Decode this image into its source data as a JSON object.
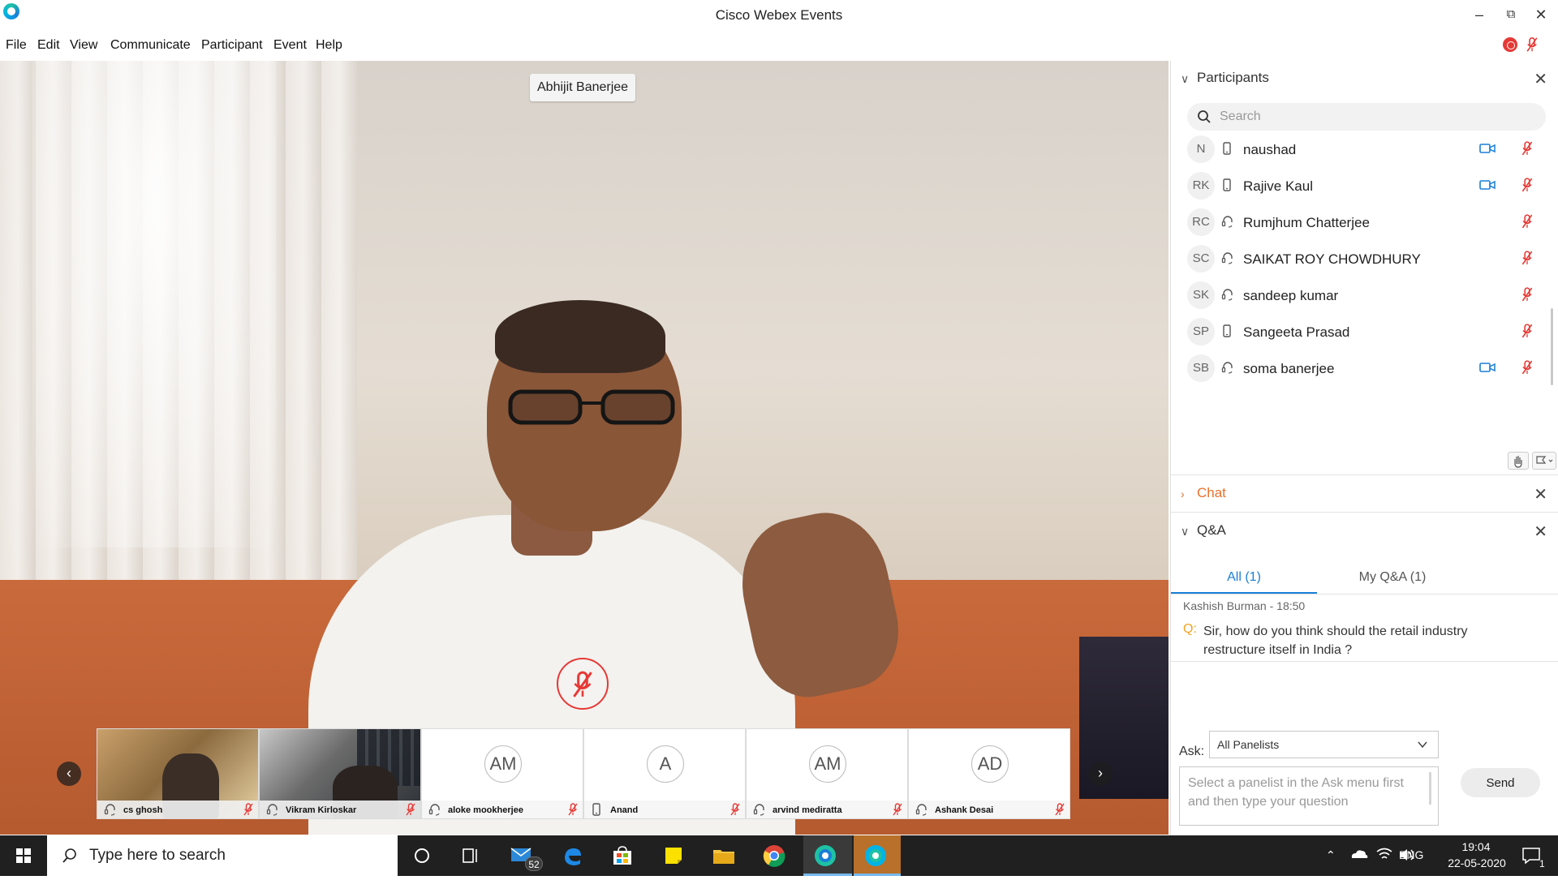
{
  "window": {
    "title": "Cisco Webex Events"
  },
  "menu": [
    {
      "label": "File"
    },
    {
      "label": "Edit"
    },
    {
      "label": "View"
    },
    {
      "label": "Communicate"
    },
    {
      "label": "Participant"
    },
    {
      "label": "Event"
    },
    {
      "label": "Help"
    }
  ],
  "video": {
    "active_speaker": "Abhijit Banerjee"
  },
  "filmstrip": [
    {
      "name": "cs ghosh",
      "initials": "",
      "device": "headset-icon",
      "has_video": true
    },
    {
      "name": "Vikram Kirloskar",
      "initials": "",
      "device": "headset-icon",
      "has_video": true
    },
    {
      "name": "aloke mookherjee",
      "initials": "AM",
      "device": "headset-icon",
      "has_video": false
    },
    {
      "name": "Anand",
      "initials": "A",
      "device": "phone-icon",
      "has_video": false
    },
    {
      "name": "arvind mediratta",
      "initials": "AM",
      "device": "headset-icon",
      "has_video": false
    },
    {
      "name": "Ashank Desai",
      "initials": "AD",
      "device": "headset-icon",
      "has_video": false
    }
  ],
  "participants": {
    "title": "Participants",
    "search_placeholder": "Search",
    "list": [
      {
        "initials": "N",
        "name": "naushad",
        "device": "phone-icon",
        "video": true
      },
      {
        "initials": "RK",
        "name": "Rajive Kaul",
        "device": "phone-icon",
        "video": true
      },
      {
        "initials": "RC",
        "name": "Rumjhum Chatterjee",
        "device": "headset-icon",
        "video": false
      },
      {
        "initials": "SC",
        "name": "SAIKAT ROY CHOWDHURY",
        "device": "headset-icon",
        "video": false
      },
      {
        "initials": "SK",
        "name": "sandeep kumar",
        "device": "headset-icon",
        "video": false
      },
      {
        "initials": "SP",
        "name": "Sangeeta Prasad",
        "device": "phone-icon",
        "video": false
      },
      {
        "initials": "SB",
        "name": "soma banerjee",
        "device": "headset-icon",
        "video": true
      }
    ]
  },
  "chat": {
    "title": "Chat"
  },
  "qa": {
    "title": "Q&A",
    "tabs": [
      {
        "label": "All (1)"
      },
      {
        "label": "My Q&A (1)"
      }
    ],
    "question": {
      "author": "Kashish Burman - 18:50",
      "prefix": "Q:",
      "text": "Sir, how do you think should the retail industry restructure itself in India ?"
    },
    "ask_label": "Ask:",
    "ask_target": "All Panelists",
    "input_placeholder": "Select a panelist in the Ask menu first and then type your question",
    "send_label": "Send"
  },
  "taskbar": {
    "search_placeholder": "Type here to search",
    "mail_badge": "52",
    "language": "ENG",
    "time": "19:04",
    "date": "22-05-2020",
    "notifications": "1"
  },
  "colors": {
    "accent": "#1a7fd6",
    "mute_red": "#e53935",
    "chat_orange": "#e8712b",
    "q_orange": "#f0a320"
  }
}
